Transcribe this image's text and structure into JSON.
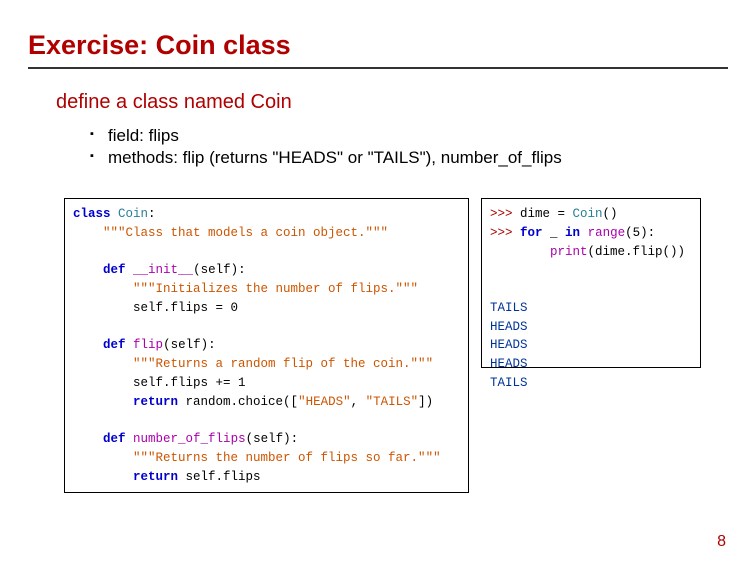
{
  "title": "Exercise: Coin class",
  "subtitle": "define a class named Coin",
  "bullets": [
    "field: flips",
    "methods: flip (returns \"HEADS\" or \"TAILS\"), number_of_flips"
  ],
  "code_left": {
    "class_kw": "class",
    "class_name": "Coin",
    "colon": ":",
    "class_doc": "\"\"\"Class that models a coin object.\"\"\"",
    "def_kw": "def",
    "init_name": "__init__",
    "self_param": "(self):",
    "init_doc": "\"\"\"Initializes the number of flips.\"\"\"",
    "init_body": "self.flips = 0",
    "flip_name": "flip",
    "flip_doc": "\"\"\"Returns a random flip of the coin.\"\"\"",
    "flip_body1": "self.flips += 1",
    "return_kw": "return",
    "flip_ret": " random.choice([",
    "heads": "\"HEADS\"",
    "comma": ", ",
    "tails": "\"TAILS\"",
    "close_list": "])",
    "nof_name": "number_of_flips",
    "nof_doc": "\"\"\"Returns the number of flips so far.\"\"\"",
    "nof_ret": " self.flips"
  },
  "code_right": {
    "p1": ">>> ",
    "l1_a": "dime = ",
    "l1_b": "Coin",
    "l1_c": "()",
    "p2": ">>> ",
    "for_kw": "for",
    "l2_a": " _ ",
    "in_kw": "in",
    "l2_b": " ",
    "range": "range",
    "l2_c": "(5):",
    "l3_a": "        ",
    "print": "print",
    "l3_b": "(dime.flip())",
    "out": [
      "TAILS",
      "HEADS",
      "HEADS",
      "HEADS",
      "TAILS"
    ]
  },
  "page_number": "8"
}
